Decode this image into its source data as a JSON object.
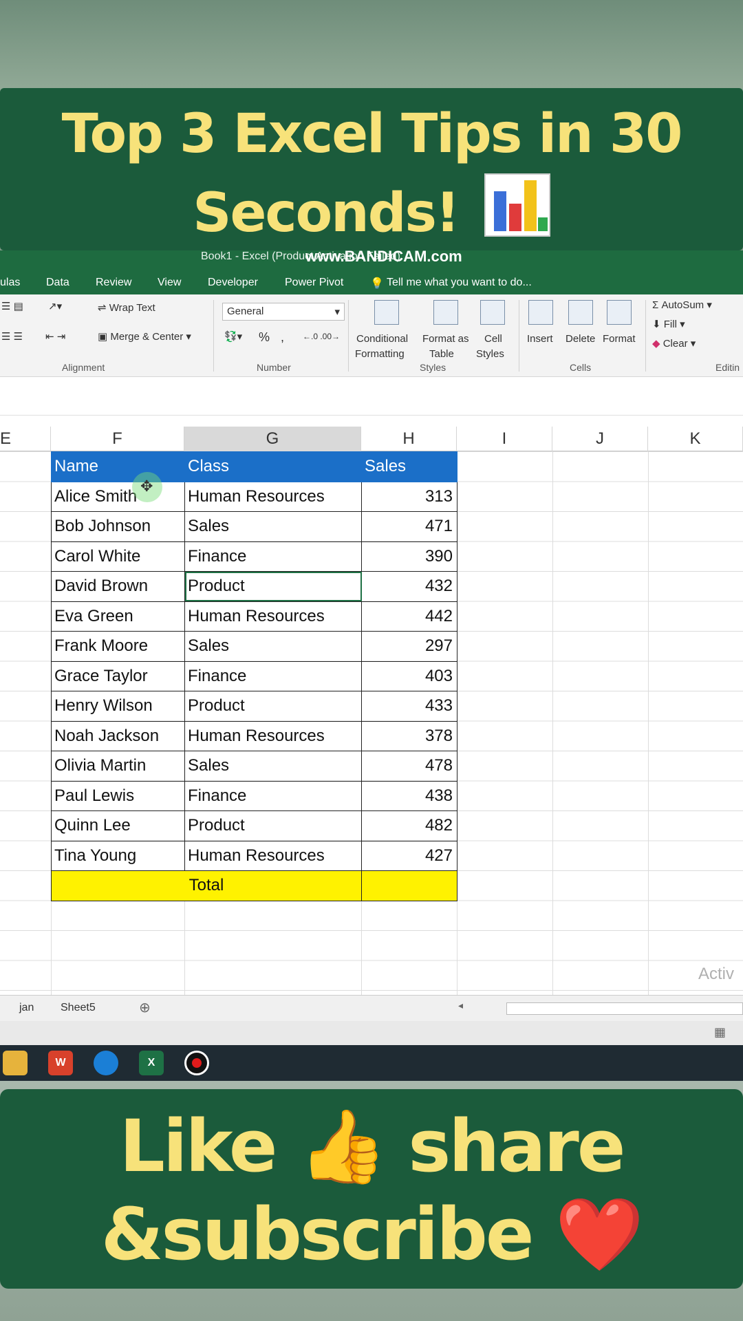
{
  "banner_top": {
    "line1": "Top 3 Excel Tips in 30",
    "line2": "Seconds!"
  },
  "banner_bottom": {
    "line1_a": "Like",
    "line1_emoji": "👍",
    "line1_b": "share",
    "line2_a": "&subscribe",
    "line2_emoji": "❤️"
  },
  "window": {
    "title": "Book1 - Excel (Product Activation Failed)",
    "watermark": "www.BANDICAM.com"
  },
  "ribbon_tabs": [
    "ulas",
    "Data",
    "Review",
    "View",
    "Developer",
    "Power Pivot",
    "Tell me what you want to do..."
  ],
  "ribbon": {
    "wrap_text": "Wrap Text",
    "merge_center": "Merge & Center",
    "number_format": "General",
    "percent": "%",
    "comma": ",",
    "conditional_formatting_1": "Conditional",
    "conditional_formatting_2": "Formatting",
    "format_as_table_1": "Format as",
    "format_as_table_2": "Table",
    "cell_styles_1": "Cell",
    "cell_styles_2": "Styles",
    "insert": "Insert",
    "delete": "Delete",
    "format": "Format",
    "autosum": "AutoSum",
    "fill": "Fill",
    "clear": "Clear",
    "groups": {
      "alignment": "Alignment",
      "number": "Number",
      "styles": "Styles",
      "cells": "Cells",
      "editing": "Editin"
    }
  },
  "columns": [
    "E",
    "F",
    "G",
    "H",
    "I",
    "J",
    "K"
  ],
  "table": {
    "headers": [
      "Name",
      "Class",
      "Sales"
    ],
    "rows": [
      [
        "Alice Smith",
        "Human Resources",
        "313"
      ],
      [
        "Bob Johnson",
        "Sales",
        "471"
      ],
      [
        "Carol White",
        "Finance",
        "390"
      ],
      [
        "David Brown",
        "Product",
        "432"
      ],
      [
        "Eva Green",
        "Human Resources",
        "442"
      ],
      [
        "Frank Moore",
        "Sales",
        "297"
      ],
      [
        "Grace Taylor",
        "Finance",
        "403"
      ],
      [
        "Henry Wilson",
        "Product",
        "433"
      ],
      [
        "Noah Jackson",
        "Human Resources",
        "378"
      ],
      [
        "Olivia Martin",
        "Sales",
        "478"
      ],
      [
        "Paul Lewis",
        "Finance",
        "438"
      ],
      [
        "Quinn Lee",
        "Product",
        "482"
      ],
      [
        "Tina Young",
        "Human Resources",
        "427"
      ]
    ],
    "total_label": "Total"
  },
  "activate_text": "Activ",
  "sheet_tabs": [
    "jan",
    "Sheet5"
  ],
  "colors": {
    "banner": "#1b5b3b",
    "banner_text": "#f7e27a",
    "excel_green": "#1e6b40",
    "header_blue": "#1b6fc8",
    "total_yellow": "#fff200"
  }
}
